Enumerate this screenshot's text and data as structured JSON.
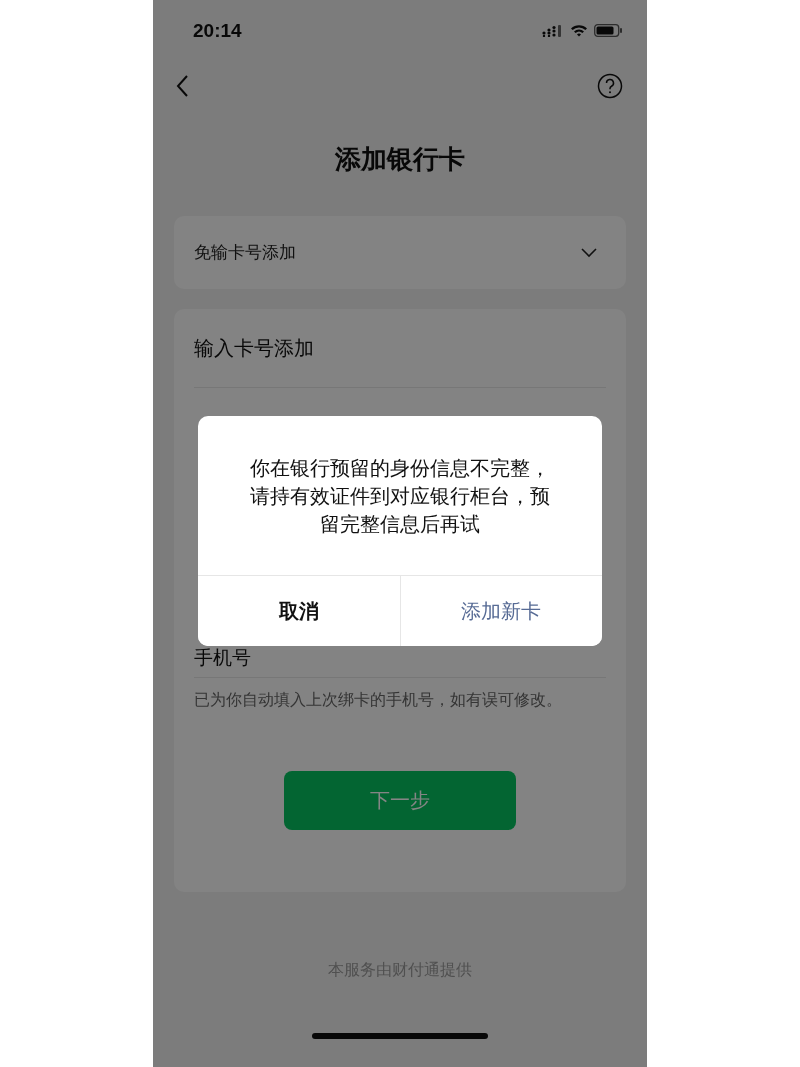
{
  "status_bar": {
    "time": "20:14"
  },
  "nav": {
    "title": "添加银行卡"
  },
  "quick_add": {
    "label": "免输卡号添加",
    "expanded": false
  },
  "card_entry": {
    "title": "输入卡号添加",
    "phone_label": "手机号",
    "note": "已为你自动填入上次绑卡的手机号，如有误可修改。"
  },
  "next_button": {
    "label": "下一步"
  },
  "footer": "本服务由财付通提供",
  "dialog": {
    "message_lines": [
      "你在银行预留的身份信息不完整，",
      "请持有效证件到对应银行柜台，预",
      "留完整信息后再试"
    ],
    "buttons": [
      {
        "label": "取消",
        "kind": "cancel"
      },
      {
        "label": "添加新卡",
        "kind": "primary"
      }
    ]
  }
}
